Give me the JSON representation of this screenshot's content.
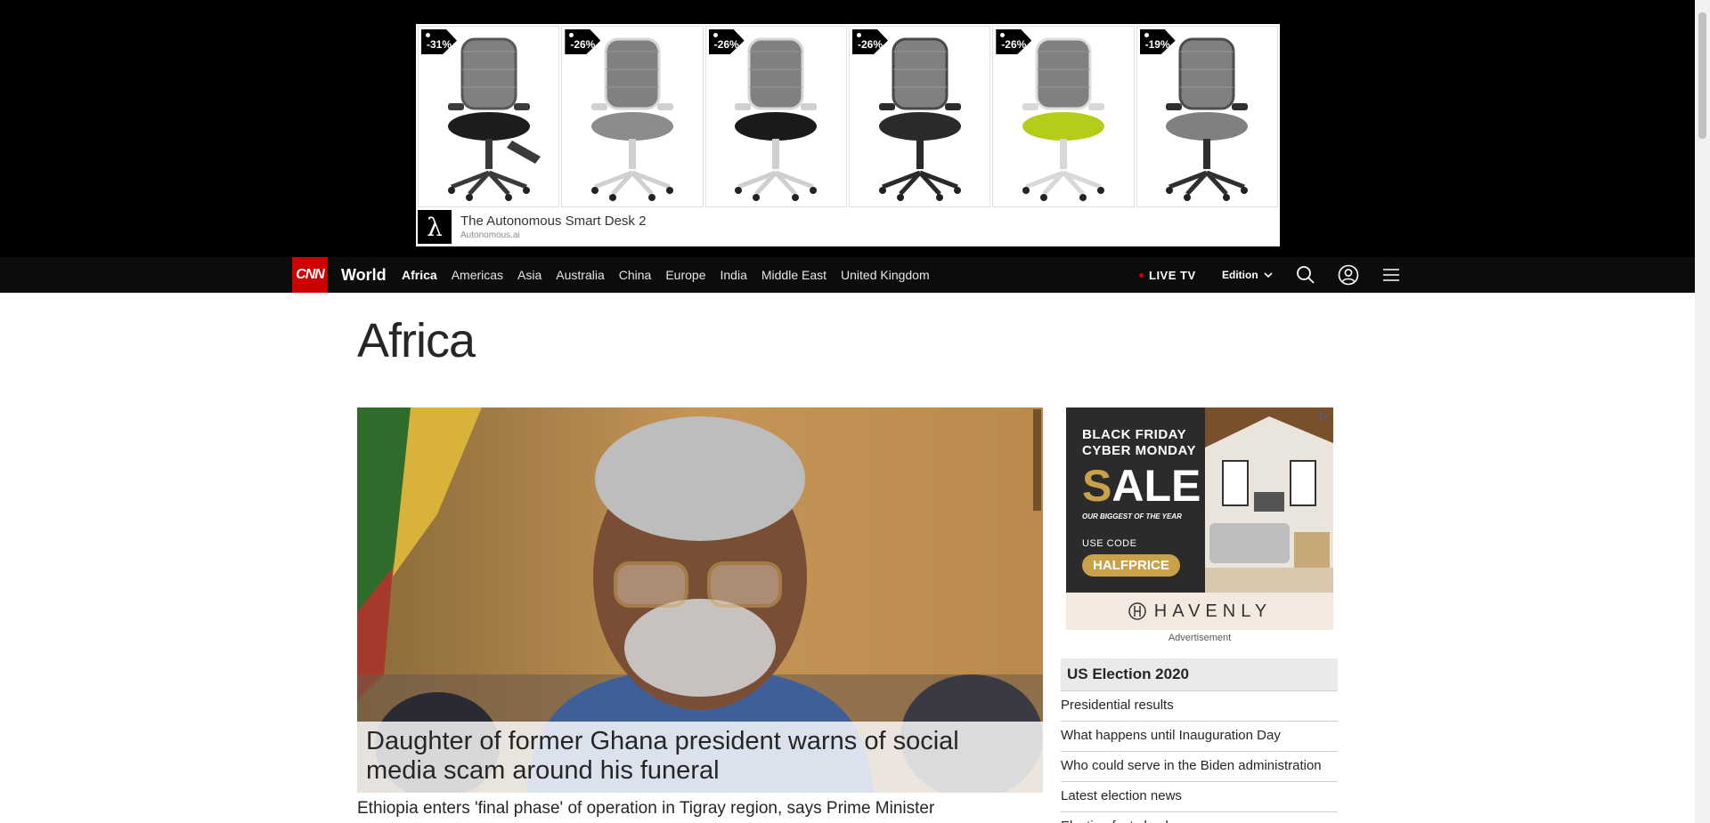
{
  "top_ad": {
    "products": [
      {
        "discount": "-31%",
        "seat_color": "#1c1c1c",
        "frame_color": "#3a3a3a",
        "footrest": true
      },
      {
        "discount": "-26%",
        "seat_color": "#8c8c8c",
        "frame_color": "#d0d0d0",
        "footrest": false
      },
      {
        "discount": "-26%",
        "seat_color": "#1a1a1a",
        "frame_color": "#cfcfcf",
        "footrest": false
      },
      {
        "discount": "-26%",
        "seat_color": "#2a2a2a",
        "frame_color": "#2a2a2a",
        "footrest": false
      },
      {
        "discount": "-26%",
        "seat_color": "#b6cc1a",
        "frame_color": "#d8d8d8",
        "footrest": false
      },
      {
        "discount": "-19%",
        "seat_color": "#808080",
        "frame_color": "#2f2f2f",
        "footrest": false
      }
    ],
    "logo_glyph": "λ",
    "title": "The Autonomous Smart Desk 2",
    "domain": "Autonomous.ai"
  },
  "nav": {
    "logo": "CNN",
    "section": "World",
    "links": [
      "Africa",
      "Americas",
      "Asia",
      "Australia",
      "China",
      "Europe",
      "India",
      "Middle East",
      "United Kingdom"
    ],
    "active_link": "Africa",
    "live_tv": "LIVE TV",
    "edition": "Edition"
  },
  "page": {
    "title": "Africa",
    "hero_caption": "Daughter of former Ghana president warns of social media scam around his funeral",
    "headline": "Ethiopia enters 'final phase' of operation in Tigray region, says Prime Minister"
  },
  "side_ad": {
    "line1": "BLACK FRIDAY",
    "line2": "CYBER MONDAY",
    "sale_first": "S",
    "sale_rest": "ALE",
    "biggest": "OUR BIGGEST OF THE YEAR",
    "use_code": "USE CODE",
    "code": "HALFPRICE",
    "brand": "HAVENLY",
    "label": "Advertisement"
  },
  "election": {
    "title": "US Election 2020",
    "items": [
      "Presidential results",
      "What happens until Inauguration Day",
      "Who could serve in the Biden administration",
      "Latest election news",
      "Election fact check"
    ]
  },
  "colors": {
    "cnn_red": "#cc0000",
    "nav_bg": "#0c0c0c",
    "gold": "#c9a14a"
  }
}
